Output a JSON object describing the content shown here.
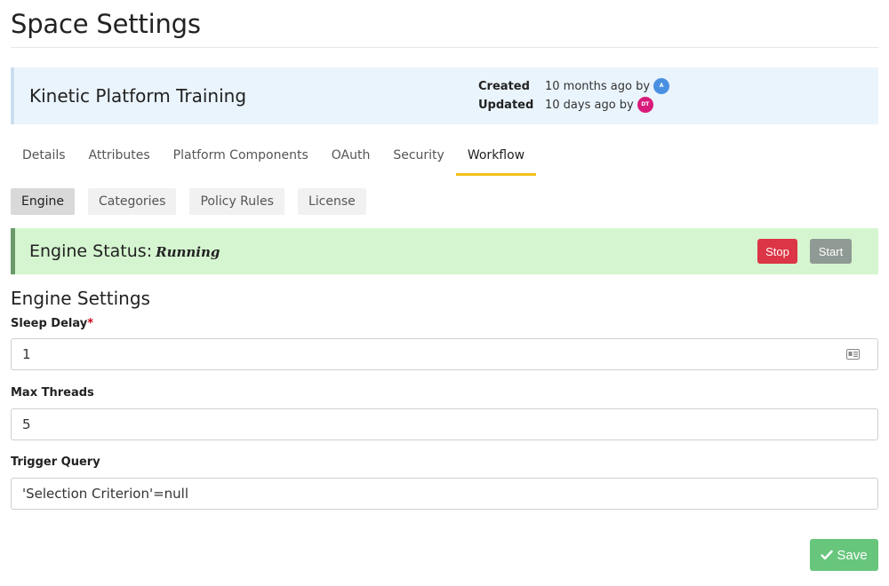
{
  "page": {
    "title": "Space Settings"
  },
  "space": {
    "name": "Kinetic Platform Training",
    "created_label": "Created",
    "created_value": "10 months ago by",
    "created_avatar": "A",
    "updated_label": "Updated",
    "updated_value": "10 days ago by",
    "updated_avatar": "DT"
  },
  "tabs": [
    {
      "label": "Details"
    },
    {
      "label": "Attributes"
    },
    {
      "label": "Platform Components"
    },
    {
      "label": "OAuth"
    },
    {
      "label": "Security"
    },
    {
      "label": "Workflow",
      "active": true
    }
  ],
  "subtabs": [
    {
      "label": "Engine",
      "active": true
    },
    {
      "label": "Categories"
    },
    {
      "label": "Policy Rules"
    },
    {
      "label": "License"
    }
  ],
  "engine": {
    "status_label": "Engine Status:",
    "status_value": "Running",
    "stop_label": "Stop",
    "start_label": "Start"
  },
  "settings": {
    "section_title": "Engine Settings",
    "sleep_delay": {
      "label": "Sleep Delay",
      "required_mark": "*",
      "value": "1"
    },
    "max_threads": {
      "label": "Max Threads",
      "value": "5"
    },
    "trigger_query": {
      "label": "Trigger Query",
      "value": "'Selection Criterion'=null"
    }
  },
  "actions": {
    "save_label": "Save"
  },
  "colors": {
    "accent_tab": "#f3c01c",
    "status_bg": "#d5f5d0",
    "stop": "#dc3545",
    "save": "#67c67c"
  }
}
